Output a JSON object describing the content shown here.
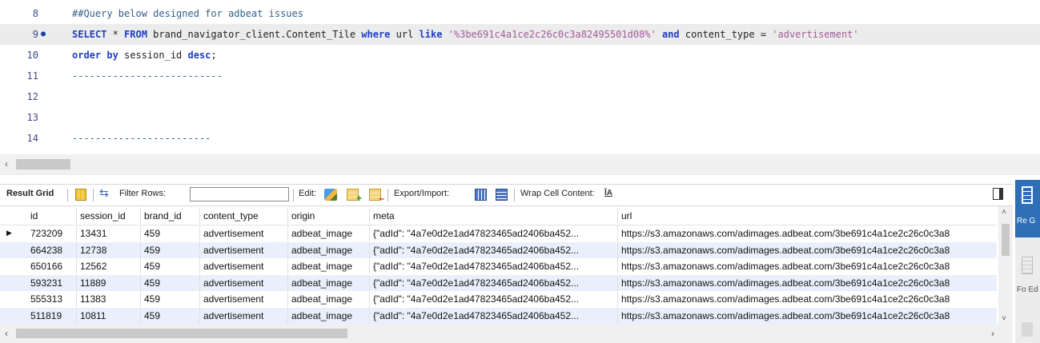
{
  "editor": {
    "lines": [
      {
        "num": "8",
        "marker": "",
        "current": false,
        "tokens": [
          {
            "t": "cm",
            "v": "##Query below designed for adbeat issues"
          }
        ]
      },
      {
        "num": "9",
        "marker": "●",
        "current": true,
        "tokens": [
          {
            "t": "kw",
            "v": "SELECT"
          },
          {
            "t": "id",
            "v": " * "
          },
          {
            "t": "kw",
            "v": "FROM"
          },
          {
            "t": "id",
            "v": " brand_navigator_client.Content_Tile "
          },
          {
            "t": "kw",
            "v": "where"
          },
          {
            "t": "id",
            "v": " url "
          },
          {
            "t": "kw",
            "v": "like"
          },
          {
            "t": "id",
            "v": " "
          },
          {
            "t": "str",
            "v": "'%3be691c4a1ce2c26c0c3a82495501d08%'"
          },
          {
            "t": "id",
            "v": " "
          },
          {
            "t": "kw",
            "v": "and"
          },
          {
            "t": "id",
            "v": " content_type = "
          },
          {
            "t": "str",
            "v": "'advertisement'"
          }
        ]
      },
      {
        "num": "10",
        "marker": "",
        "current": false,
        "tokens": [
          {
            "t": "kw",
            "v": "order by"
          },
          {
            "t": "id",
            "v": " session_id "
          },
          {
            "t": "kw",
            "v": "desc"
          },
          {
            "t": "id",
            "v": ";"
          }
        ]
      },
      {
        "num": "11",
        "marker": "",
        "current": false,
        "tokens": [
          {
            "t": "cm",
            "v": "--------------------------"
          }
        ]
      },
      {
        "num": "12",
        "marker": "",
        "current": false,
        "tokens": []
      },
      {
        "num": "13",
        "marker": "",
        "current": false,
        "tokens": []
      },
      {
        "num": "14",
        "marker": "",
        "current": false,
        "tokens": [
          {
            "t": "cm",
            "v": "------------------------"
          }
        ]
      }
    ]
  },
  "toolbar": {
    "result_grid_label": "Result Grid",
    "filter_rows_label": "Filter Rows:",
    "filter_value": "",
    "edit_label": "Edit:",
    "export_import_label": "Export/Import:",
    "wrap_cell_label": "Wrap Cell Content:",
    "wrap_icon_glyph": "ĪA"
  },
  "grid": {
    "columns": [
      "id",
      "session_id",
      "brand_id",
      "content_type",
      "origin",
      "meta",
      "url"
    ],
    "rows": [
      [
        "723209",
        "13431",
        "459",
        "advertisement",
        "adbeat_image",
        "{\"adId\": \"4a7e0d2e1ad47823465ad2406ba452...",
        "https://s3.amazonaws.com/adimages.adbeat.com/3be691c4a1ce2c26c0c3a8"
      ],
      [
        "664238",
        "12738",
        "459",
        "advertisement",
        "adbeat_image",
        "{\"adId\": \"4a7e0d2e1ad47823465ad2406ba452...",
        "https://s3.amazonaws.com/adimages.adbeat.com/3be691c4a1ce2c26c0c3a8"
      ],
      [
        "650166",
        "12562",
        "459",
        "advertisement",
        "adbeat_image",
        "{\"adId\": \"4a7e0d2e1ad47823465ad2406ba452...",
        "https://s3.amazonaws.com/adimages.adbeat.com/3be691c4a1ce2c26c0c3a8"
      ],
      [
        "593231",
        "11889",
        "459",
        "advertisement",
        "adbeat_image",
        "{\"adId\": \"4a7e0d2e1ad47823465ad2406ba452...",
        "https://s3.amazonaws.com/adimages.adbeat.com/3be691c4a1ce2c26c0c3a8"
      ],
      [
        "555313",
        "11383",
        "459",
        "advertisement",
        "adbeat_image",
        "{\"adId\": \"4a7e0d2e1ad47823465ad2406ba452...",
        "https://s3.amazonaws.com/adimages.adbeat.com/3be691c4a1ce2c26c0c3a8"
      ],
      [
        "511819",
        "10811",
        "459",
        "advertisement",
        "adbeat_image",
        "{\"adId\": \"4a7e0d2e1ad47823465ad2406ba452...",
        "https://s3.amazonaws.com/adimages.adbeat.com/3be691c4a1ce2c26c0c3a8"
      ]
    ]
  },
  "side_panel": {
    "result_grid_label": "Re G",
    "form_editor_label": "Fo Ed"
  },
  "colors": {
    "keyword": "#1f3fc4",
    "string": "#a25a9a",
    "comment": "#356089",
    "alt_row": "#eaf0fb",
    "side_active": "#2f6fb7"
  }
}
